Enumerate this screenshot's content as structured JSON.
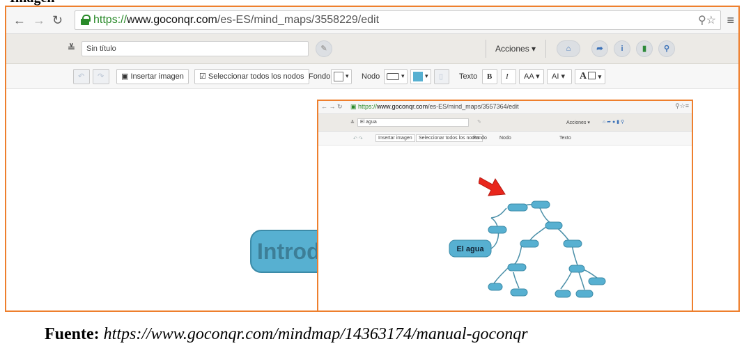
{
  "header": {
    "label": "Imagen"
  },
  "browser": {
    "url": {
      "scheme": "https://",
      "host": "www.goconqr.com",
      "path": "/es-ES/mind_maps/3558229/edit"
    }
  },
  "app_toolbar": {
    "title_value": "Sin título",
    "acciones_label": "Acciones ▾"
  },
  "format_toolbar": {
    "insert_image_label": "Insertar imagen",
    "select_all_label": "Seleccionar todos los nodos",
    "fondo_label": "Fondo",
    "nodo_label": "Nodo",
    "texto_label": "Texto",
    "bold_label": "B",
    "italic_label": "I",
    "fontsize_label": "AA",
    "alt_label": "AI",
    "textcolor_label": "A"
  },
  "canvas": {
    "main_node_label": "Introd"
  },
  "inset": {
    "url": {
      "scheme": "https://",
      "host": "www.goconqr.com",
      "path": "/es-ES/mind_maps/3557364/edit"
    },
    "title_value": "El agua",
    "acciones_label": "Acciones ▾",
    "insert_image_label": "Insertar imagen",
    "select_all_label": "Seleccionar todos los nodos",
    "fondo_label": "Fondo",
    "nodo_label": "Nodo",
    "texto_label": "Texto",
    "mindmap_root": "El agua",
    "arrow_color": "#e8261c"
  },
  "colors": {
    "accent_border": "#ee7f2d",
    "node_fill": "#57b0d1",
    "node_border": "#3c8ba8"
  },
  "caption": {
    "label": "Fuente:",
    "source": "https://www.goconqr.com/mindmap/14363174/manual-goconqr"
  }
}
